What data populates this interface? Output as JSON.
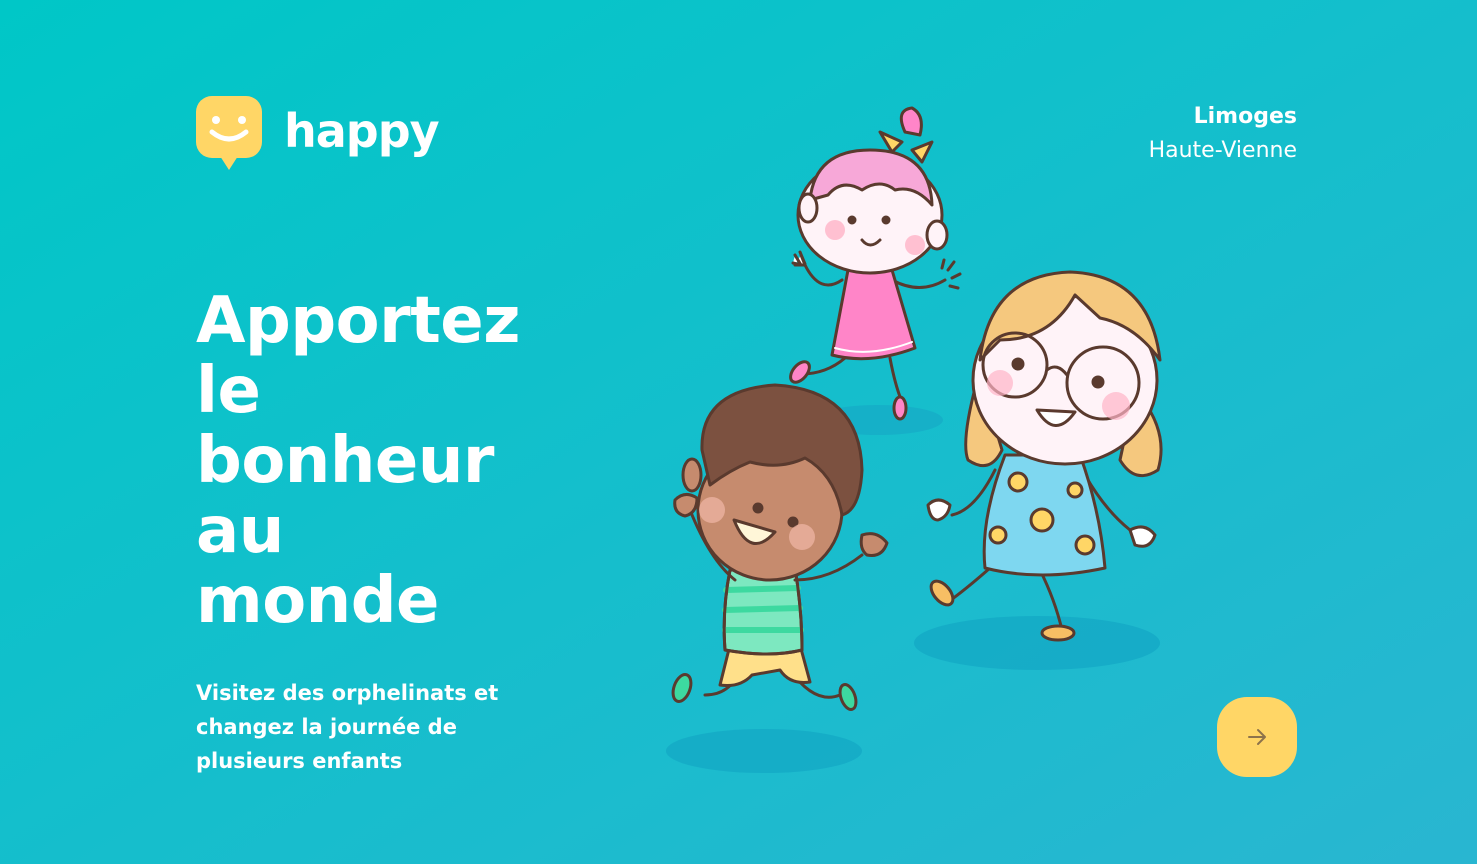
{
  "brand": {
    "name": "happy",
    "logo_icon": "smiley-chat-bubble-icon",
    "accent": "#FFD666"
  },
  "location": {
    "city": "Limoges",
    "region": "Haute-Vienne"
  },
  "hero": {
    "title_lines": [
      "Apportez",
      "le",
      "bonheur",
      "au",
      "monde"
    ],
    "subtitle": "Visitez des orphelinats et changez la journée de plusieurs enfants"
  },
  "illustration": {
    "subject": "three-happy-children-icon"
  },
  "enter_button": {
    "icon": "arrow-right-icon",
    "color": "#FFD666"
  },
  "colors": {
    "background_start": "#00C7C7",
    "background_end": "#29B6D1",
    "text": "#FFFFFF"
  }
}
